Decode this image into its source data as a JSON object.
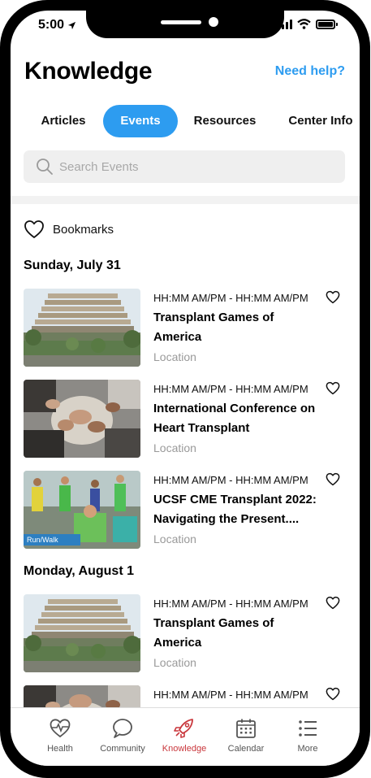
{
  "status": {
    "time": "5:00"
  },
  "header": {
    "title": "Knowledge",
    "help_link": "Need help?"
  },
  "tabs": [
    {
      "label": "Articles",
      "active": false
    },
    {
      "label": "Events",
      "active": true
    },
    {
      "label": "Resources",
      "active": false
    },
    {
      "label": "Center Info",
      "active": false
    }
  ],
  "search": {
    "placeholder": "Search Events",
    "value": ""
  },
  "bookmarks_label": "Bookmarks",
  "sections": [
    {
      "date": "Sunday, July 31",
      "events": [
        {
          "time": "HH:MM AM/PM -  HH:MM AM/PM",
          "title": "Transplant Games of America",
          "location": "Location",
          "image": "building"
        },
        {
          "time": "HH:MM AM/PM -  HH:MM AM/PM",
          "title": "International Conference on Heart Transplant",
          "location": "Location",
          "image": "hands"
        },
        {
          "time": "HH:MM AM/PM -  HH:MM AM/PM",
          "title": "UCSF CME Transplant 2022: Navigating the Present....",
          "location": "Location",
          "image": "runners",
          "image_caption": "Run/Walk"
        }
      ]
    },
    {
      "date": "Monday, August 1",
      "events": [
        {
          "time": "HH:MM AM/PM -  HH:MM AM/PM",
          "title": "Transplant Games of America",
          "location": "Location",
          "image": "building"
        },
        {
          "time": "HH:MM AM/PM -  HH:MM AM/PM",
          "title": "",
          "location": "",
          "image": "hands"
        }
      ]
    }
  ],
  "bottom_nav": [
    {
      "label": "Health",
      "icon": "heart-pulse-icon",
      "active": false
    },
    {
      "label": "Community",
      "icon": "chat-bubble-icon",
      "active": false
    },
    {
      "label": "Knowledge",
      "icon": "rocket-icon",
      "active": true
    },
    {
      "label": "Calendar",
      "icon": "calendar-icon",
      "active": false
    },
    {
      "label": "More",
      "icon": "list-icon",
      "active": false
    }
  ],
  "colors": {
    "accent": "#2d9cf0",
    "active_nav": "#c9373c",
    "muted_text": "#9a9a9a"
  }
}
